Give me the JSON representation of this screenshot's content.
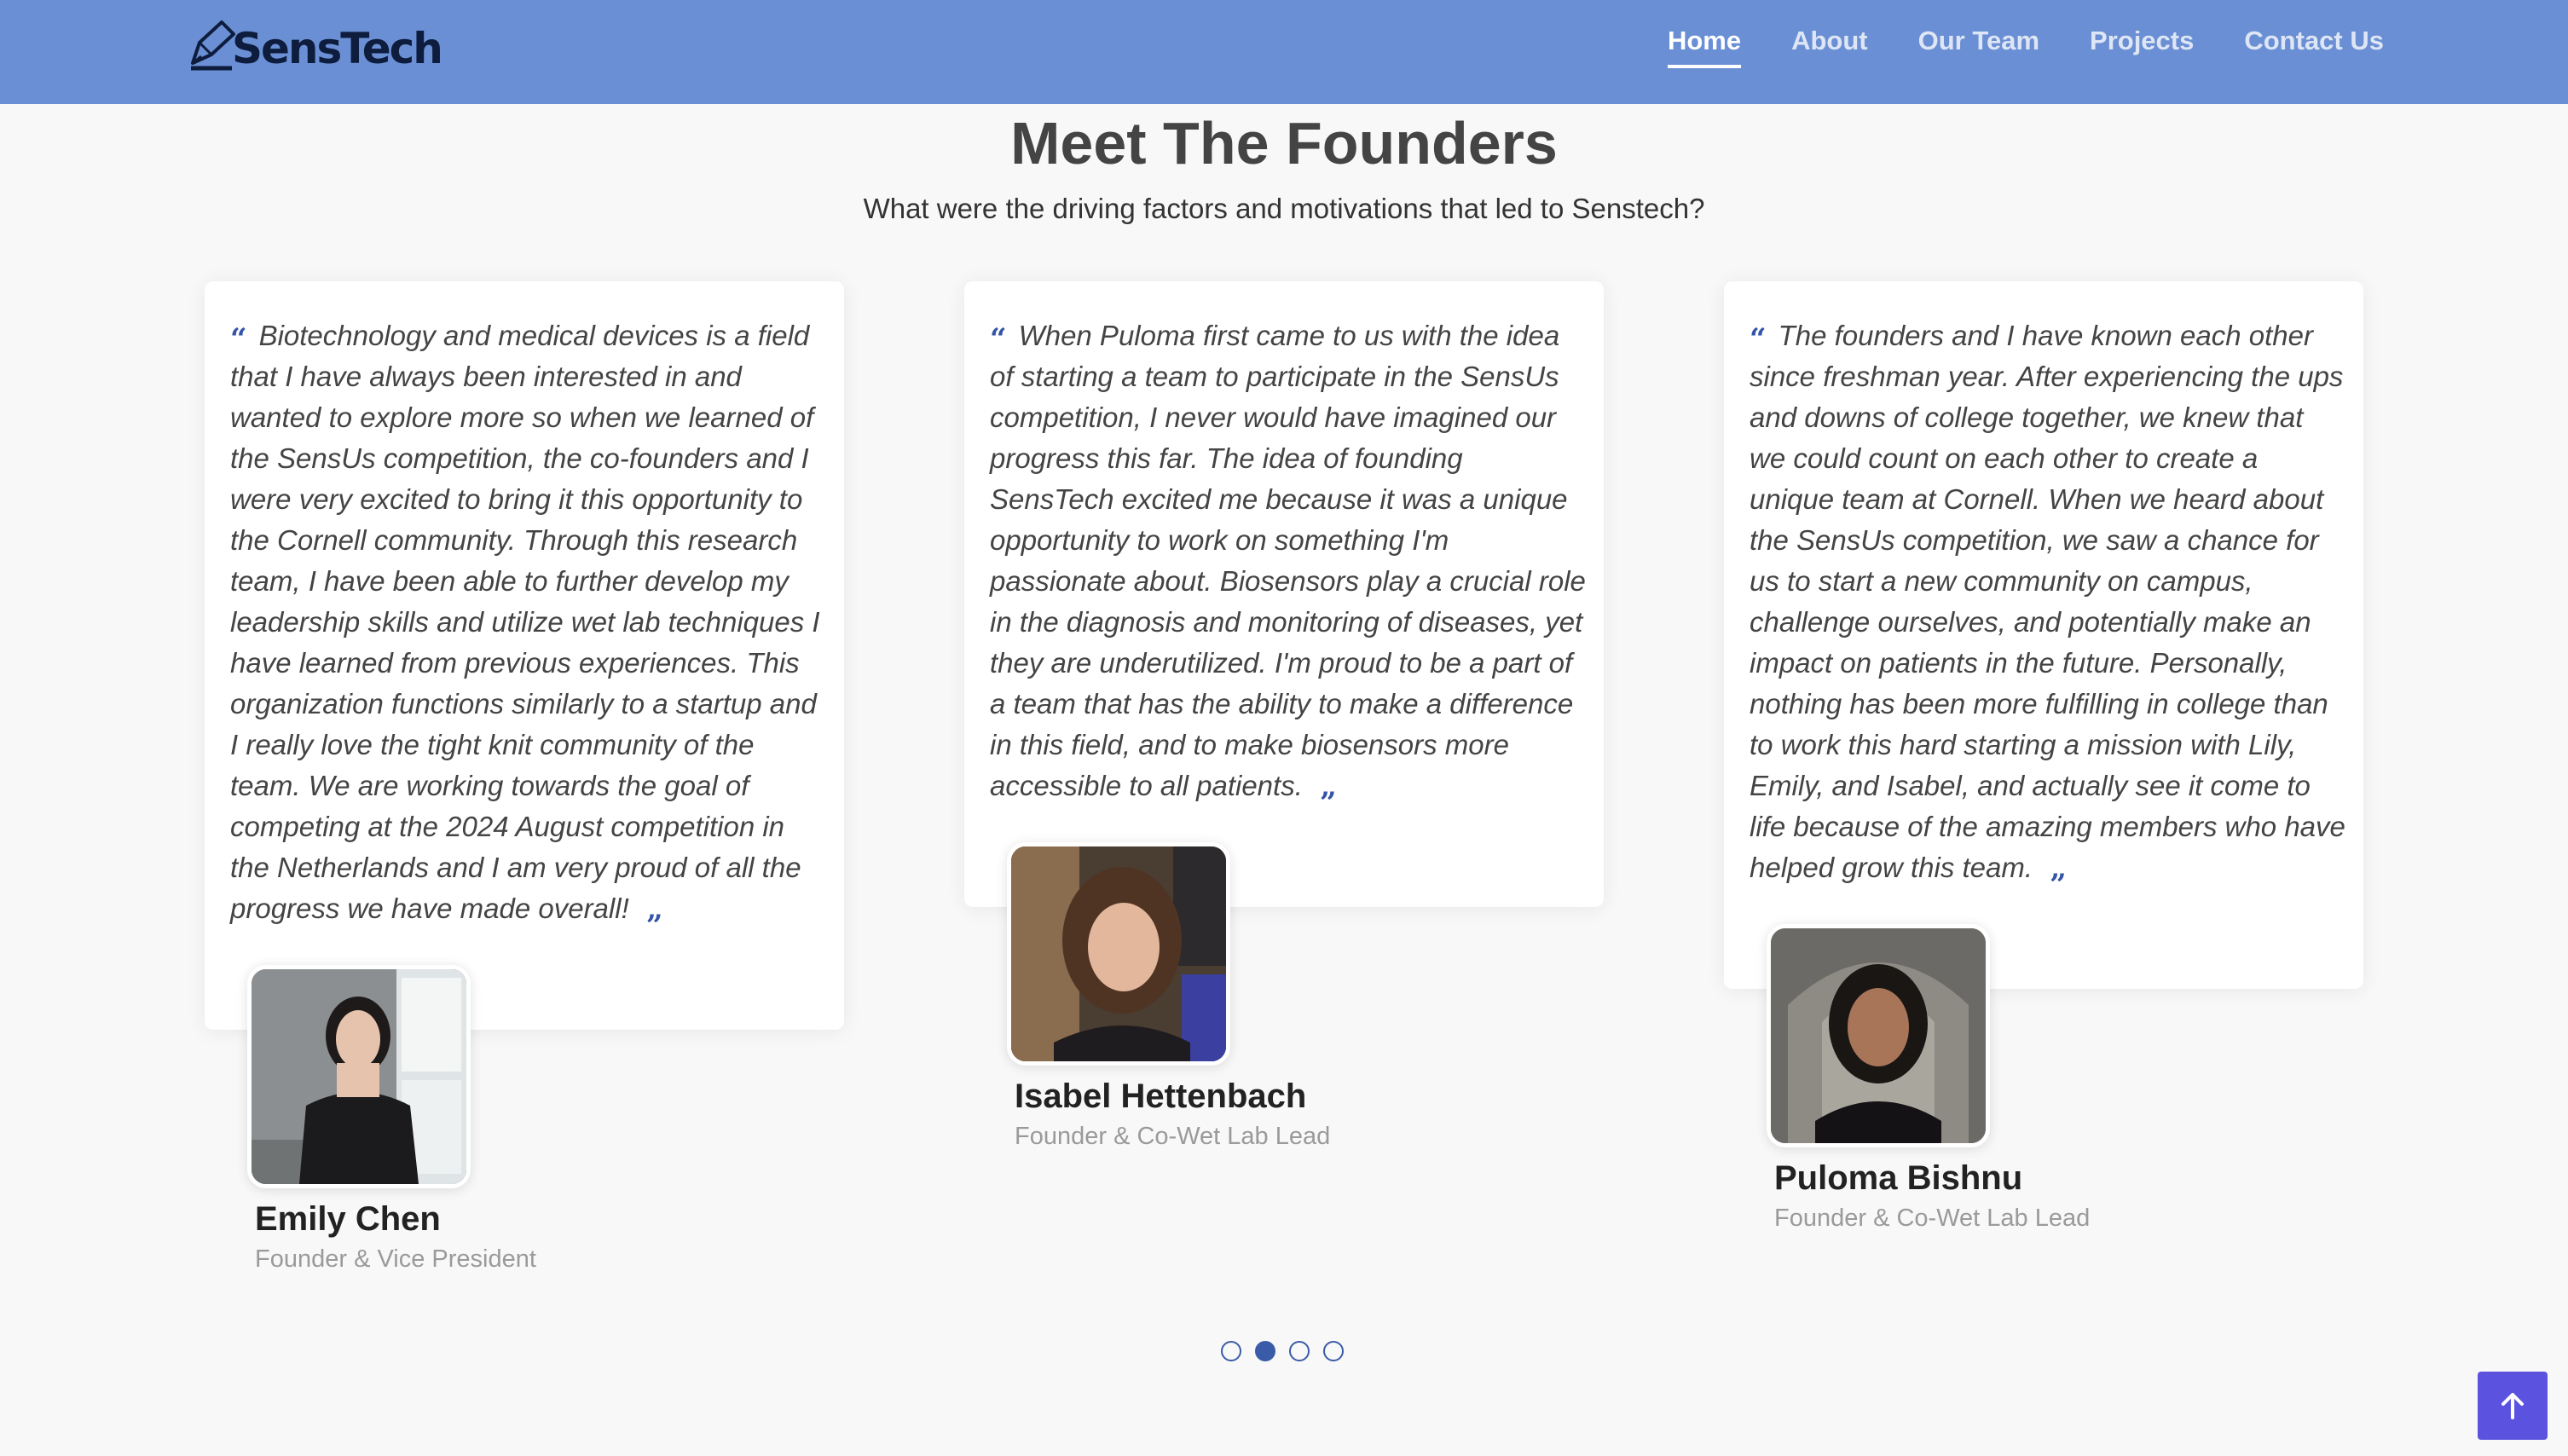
{
  "header": {
    "logo_text": "SensTech",
    "nav": [
      {
        "label": "Home",
        "active": true
      },
      {
        "label": "About",
        "active": false
      },
      {
        "label": "Our Team",
        "active": false
      },
      {
        "label": "Projects",
        "active": false
      },
      {
        "label": "Contact Us",
        "active": false
      }
    ]
  },
  "section": {
    "title": "Meet The Founders",
    "subtitle": "What were the driving factors and motivations that led to Senstech?"
  },
  "testimonials": [
    {
      "quote": "Biotechnology and medical devices is a field that I have always been interested in and wanted to explore more so when we learned of the SensUs competition, the co-founders and I were very excited to bring it this opportunity to the Cornell community. Through this research team, I have been able to further develop my leadership skills and utilize wet lab techniques I have learned from previous experiences. This organization functions similarly to a startup and I really love the tight knit community of the team. We are working towards the goal of competing at the 2024 August competition in the Netherlands and I am very proud of all the progress we have made overall!",
      "name": "Emily Chen",
      "role": "Founder & Vice President"
    },
    {
      "quote": "When Puloma first came to us with the idea of starting a team to participate in the SensUs competition, I never would have imagined our progress this far. The idea of founding SensTech excited me because it was a unique opportunity to work on something I'm passionate about. Biosensors play a crucial role in the diagnosis and monitoring of diseases, yet they are underutilized. I'm proud to be a part of a team that has the ability to make a difference in this field, and to make biosensors more accessible to all patients.",
      "name": "Isabel Hettenbach",
      "role": "Founder & Co-Wet Lab Lead"
    },
    {
      "quote": "The founders and I have known each other since freshman year. After experiencing the ups and downs of college together, we knew that we could count on each other to create a unique team at Cornell. When we heard about the SensUs competition, we saw a chance for us to start a new community on campus, challenge ourselves, and potentially make an impact on patients in the future. Personally, nothing has been more fulfilling in college than to work this hard starting a mission with Lily, Emily, and Isabel, and actually see it come to life because of the amazing members who have helped grow this team.",
      "name": "Puloma Bishnu",
      "role": "Founder & Co-Wet Lab Lead"
    }
  ],
  "quote_marks": {
    "open": "“",
    "close": "”"
  },
  "carousel": {
    "dot_count": 4,
    "active_index": 1
  },
  "colors": {
    "header_bg": "#6a8fd4",
    "accent": "#3a5ba8",
    "back_to_top": "#5b53e0",
    "page_bg": "#f8f8f8"
  },
  "icons": {
    "logo": "pen-logo-icon",
    "back_to_top": "arrow-up-icon"
  }
}
